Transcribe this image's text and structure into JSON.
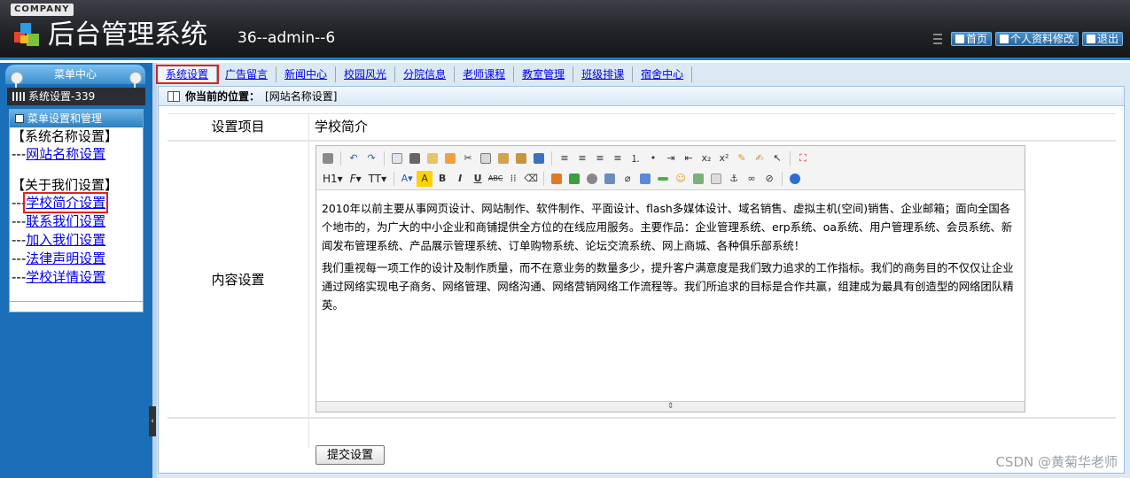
{
  "header": {
    "company": "COMPANY",
    "title": "后台管理系统",
    "user": "36--admin--6",
    "links": [
      {
        "label": "首页",
        "icon": "home-icon"
      },
      {
        "label": "个人资料修改",
        "icon": "profile-icon"
      },
      {
        "label": "退出",
        "icon": "power-icon"
      }
    ]
  },
  "sidebar": {
    "menu_center": "菜单中心",
    "system_bar": "系统设置-339",
    "panel_title": "菜单设置和管理",
    "groups": [
      {
        "title": "【系统名称设置】",
        "items": [
          {
            "prefix": "---",
            "label": "网站名称设置"
          }
        ]
      },
      {
        "title": "【关于我们设置】",
        "items": [
          {
            "prefix": "---",
            "label": "学校简介设置",
            "selected": true
          },
          {
            "prefix": "---",
            "label": "联系我们设置"
          },
          {
            "prefix": "---",
            "label": "加入我们设置"
          },
          {
            "prefix": "---",
            "label": "法律声明设置"
          },
          {
            "prefix": "---",
            "label": "学校详情设置"
          }
        ]
      }
    ]
  },
  "tabs": [
    "系统设置",
    "广告留言",
    "新闻中心",
    "校园风光",
    "分院信息",
    "老师课程",
    "教室管理",
    "班级排课",
    "宿舍中心"
  ],
  "active_tab": "系统设置",
  "breadcrumb": {
    "label": "你当前的位置：",
    "value": "[网站名称设置]"
  },
  "form": {
    "row1_label": "设置项目",
    "row1_value": "学校简介",
    "row2_label": "内容设置",
    "editor": {
      "headings_btn": "H1",
      "font_btn": "F",
      "size_btn": "TT",
      "paragraph1": "2010年以前主要从事网页设计、网站制作、软件制作、平面设计、flash多媒体设计、域名销售、虚拟主机(空间)销售、企业邮箱；面向全国各个地市的，为广大的中小企业和商铺提供全方位的在线应用服务。主要作品：企业管理系统、erp系统、oa系统、用户管理系统、会员系统、新闻发布管理系统、产品展示管理系统、订单购物系统、论坛交流系统、网上商城、各种俱乐部系统！",
      "paragraph2": "我们重视每一项工作的设计及制作质量，而不在意业务的数量多少，提升客户满意度是我们致力追求的工作指标。我们的商务目的不仅仅让企业通过网络实现电子商务、网络管理、网络沟通、网络营销网络工作流程等。我们所追求的目标是合作共赢，组建成为最具有创造型的网络团队精英。"
    },
    "submit": "提交设置"
  },
  "watermark": "CSDN @黄菊华老师",
  "colors": {
    "accent": "#1a6fb8",
    "highlight": "#e02020",
    "link": "#0000ee"
  }
}
